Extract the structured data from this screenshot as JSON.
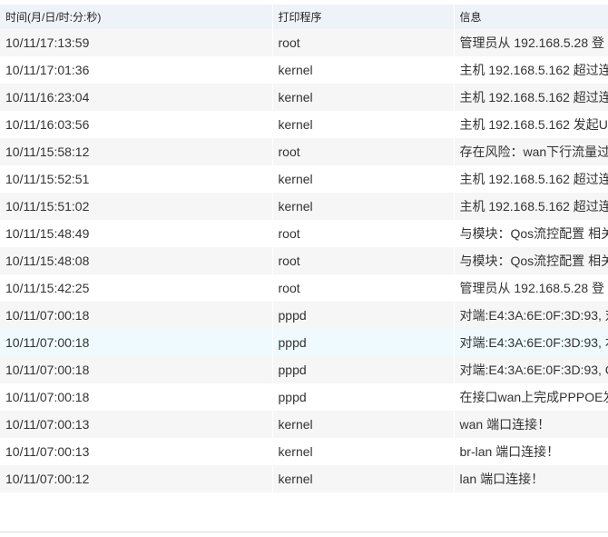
{
  "headers": {
    "time": "时间(月/日/时:分:秒)",
    "printer": "打印程序",
    "info": "信息"
  },
  "rows": [
    {
      "time": "10/11/17:13:59",
      "printer": "root",
      "info": "管理员从 192.168.5.28 登"
    },
    {
      "time": "10/11/17:01:36",
      "printer": "kernel",
      "info": "主机 192.168.5.162 超过连"
    },
    {
      "time": "10/11/16:23:04",
      "printer": "kernel",
      "info": "主机 192.168.5.162 超过连"
    },
    {
      "time": "10/11/16:03:56",
      "printer": "kernel",
      "info": "主机 192.168.5.162 发起U"
    },
    {
      "time": "10/11/15:58:12",
      "printer": "root",
      "info": "存在风险：wan下行流量过"
    },
    {
      "time": "10/11/15:52:51",
      "printer": "kernel",
      "info": "主机 192.168.5.162 超过连"
    },
    {
      "time": "10/11/15:51:02",
      "printer": "kernel",
      "info": "主机 192.168.5.162 超过连"
    },
    {
      "time": "10/11/15:48:49",
      "printer": "root",
      "info": "与模块：Qos流控配置 相关"
    },
    {
      "time": "10/11/15:48:08",
      "printer": "root",
      "info": "与模块：Qos流控配置 相关"
    },
    {
      "time": "10/11/15:42:25",
      "printer": "root",
      "info": "管理员从 192.168.5.28 登"
    },
    {
      "time": "10/11/07:00:18",
      "printer": "pppd",
      "info": "对端:E4:3A:6E:0F:3D:93, 对"
    },
    {
      "time": "10/11/07:00:18",
      "printer": "pppd",
      "info": "对端:E4:3A:6E:0F:3D:93, 本"
    },
    {
      "time": "10/11/07:00:18",
      "printer": "pppd",
      "info": "对端:E4:3A:6E:0F:3D:93, C"
    },
    {
      "time": "10/11/07:00:18",
      "printer": "pppd",
      "info": "在接口wan上完成PPPOE发"
    },
    {
      "time": "10/11/07:00:13",
      "printer": "kernel",
      "info": "wan 端口连接！"
    },
    {
      "time": "10/11/07:00:13",
      "printer": "kernel",
      "info": "br-lan 端口连接！"
    },
    {
      "time": "10/11/07:00:12",
      "printer": "kernel",
      "info": "lan 端口连接！"
    }
  ],
  "hovered_row_index": 11
}
